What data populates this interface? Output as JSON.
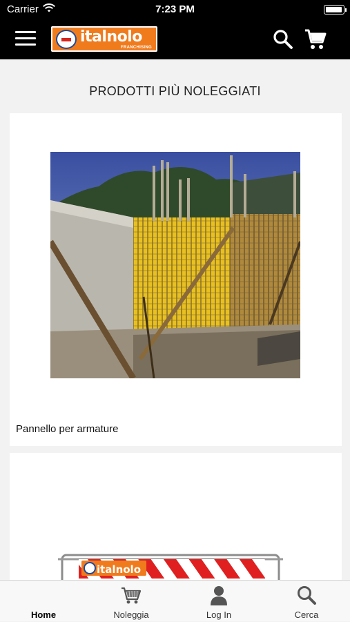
{
  "status_bar": {
    "carrier": "Carrier",
    "time": "7:23 PM",
    "battery_level": 1.0
  },
  "nav": {
    "logo_text": "italnolo",
    "logo_subtext": "FRANCHISING",
    "menu_icon": "hamburger-icon",
    "search_icon": "search-icon",
    "cart_icon": "cart-icon"
  },
  "main": {
    "section_title": "PRODOTTI PIÙ NOLEGGIATI",
    "products": [
      {
        "name": "Pannello per armature"
      },
      {
        "name": "",
        "banner_text": "italnolo"
      }
    ]
  },
  "tabs": [
    {
      "label": "Home",
      "icon": "",
      "active": true
    },
    {
      "label": "Noleggia",
      "icon": "cart-icon"
    },
    {
      "label": "Log In",
      "icon": "user-icon"
    },
    {
      "label": "Cerca",
      "icon": "search-icon"
    }
  ],
  "colors": {
    "navbar_bg": "#000000",
    "brand_orange": "#f07b1d",
    "page_bg": "#f2f2f2",
    "card_bg": "#ffffff",
    "tabbar_bg": "#f8f8f8"
  }
}
